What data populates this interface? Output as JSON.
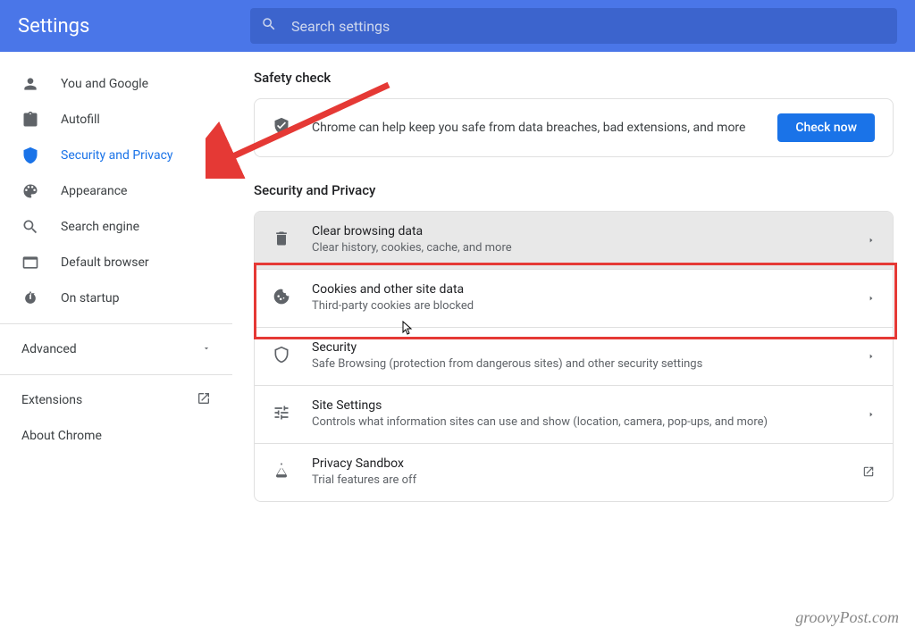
{
  "header": {
    "title": "Settings",
    "search_placeholder": "Search settings"
  },
  "sidebar": {
    "items": [
      {
        "label": "You and Google"
      },
      {
        "label": "Autofill"
      },
      {
        "label": "Security and Privacy"
      },
      {
        "label": "Appearance"
      },
      {
        "label": "Search engine"
      },
      {
        "label": "Default browser"
      },
      {
        "label": "On startup"
      }
    ],
    "advanced_label": "Advanced",
    "extensions_label": "Extensions",
    "about_label": "About Chrome"
  },
  "safety": {
    "heading": "Safety check",
    "text": "Chrome can help keep you safe from data breaches, bad extensions, and more",
    "button": "Check now"
  },
  "privacy": {
    "heading": "Security and Privacy",
    "rows": [
      {
        "title": "Clear browsing data",
        "sub": "Clear history, cookies, cache, and more"
      },
      {
        "title": "Cookies and other site data",
        "sub": "Third-party cookies are blocked"
      },
      {
        "title": "Security",
        "sub": "Safe Browsing (protection from dangerous sites) and other security settings"
      },
      {
        "title": "Site Settings",
        "sub": "Controls what information sites can use and show (location, camera, pop-ups, and more)"
      },
      {
        "title": "Privacy Sandbox",
        "sub": "Trial features are off"
      }
    ]
  },
  "watermark": "groovyPost.com"
}
